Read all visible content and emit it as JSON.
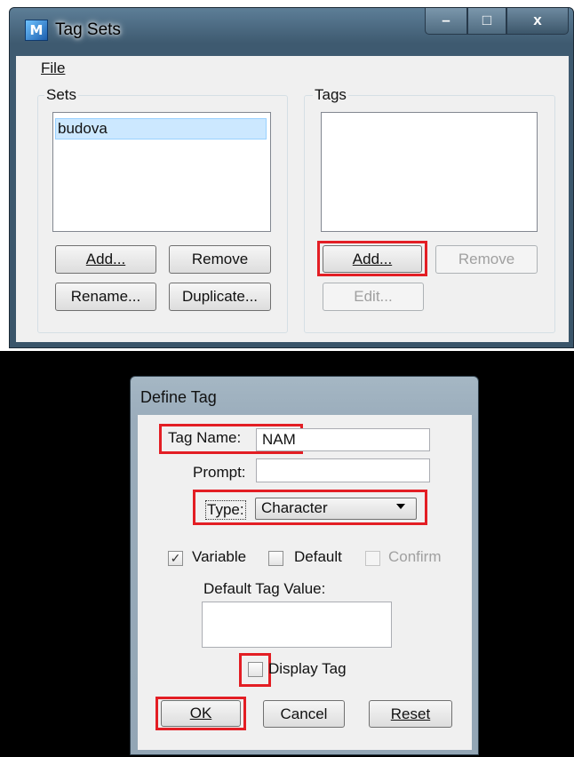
{
  "tagsets": {
    "title": "Tag Sets",
    "app_icon": "M",
    "controls": {
      "minimize": "–",
      "maximize": "□",
      "close": "x"
    },
    "menu": {
      "file": "File"
    },
    "sets": {
      "label": "Sets",
      "items": [
        "budova"
      ],
      "add": "Add...",
      "remove": "Remove",
      "rename": "Rename...",
      "duplicate": "Duplicate..."
    },
    "tags": {
      "label": "Tags",
      "add": "Add...",
      "remove": "Remove",
      "edit": "Edit..."
    }
  },
  "definetag": {
    "title": "Define Tag",
    "tag_name_label": "Tag Name:",
    "tag_name_value": "NAM",
    "prompt_label": "Prompt:",
    "prompt_value": "",
    "type_label": "Type:",
    "type_value": "Character",
    "variable_label": "Variable",
    "variable_checked": true,
    "default_label": "Default",
    "default_checked": false,
    "confirm_label": "Confirm",
    "confirm_checked": false,
    "default_value_label": "Default Tag Value:",
    "default_value": "",
    "display_tag_label": "Display Tag",
    "display_tag_checked": false,
    "ok": "OK",
    "cancel": "Cancel",
    "reset": "Reset"
  },
  "colors": {
    "highlight": "#e31e24",
    "selection": "#cce8ff"
  }
}
